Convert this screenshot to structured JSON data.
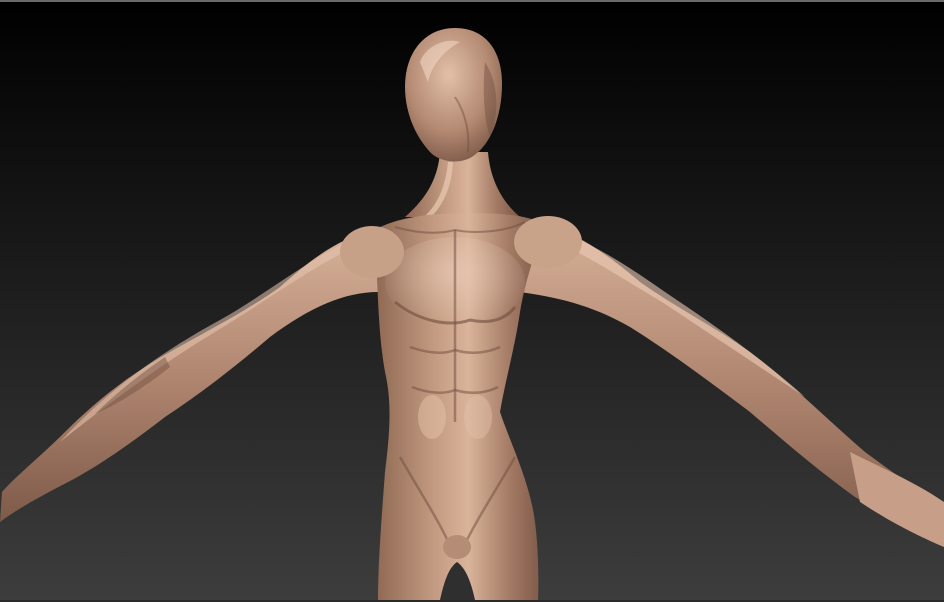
{
  "viewport": {
    "background_top": "#000000",
    "background_bottom": "#3d3d3d",
    "border_top": "#6a6a6a"
  },
  "model": {
    "material_base": "#a87e66",
    "material_highlight": "#e3bfa7",
    "material_shadow": "#5a3d2e"
  }
}
